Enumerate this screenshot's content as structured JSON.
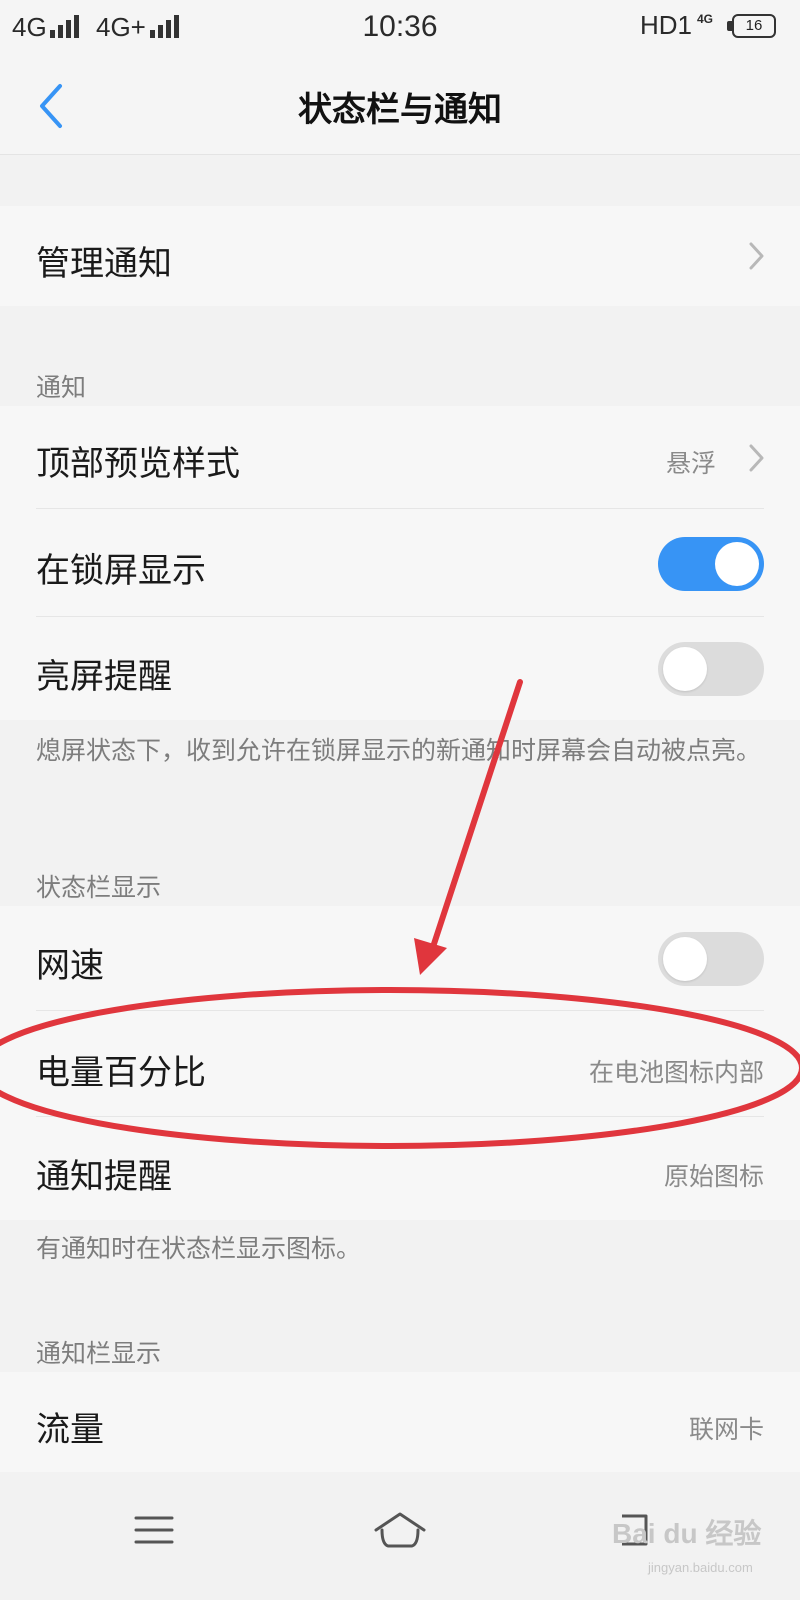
{
  "status_bar": {
    "carrier1": "4G",
    "carrier2": "4G+",
    "time": "10:36",
    "right_label": "HD1",
    "small_label": "4G",
    "battery": "16"
  },
  "header": {
    "title": "状态栏与通知",
    "back_icon": "chevron-left-icon"
  },
  "manage": {
    "label": "管理通知"
  },
  "notification_section": {
    "header": "通知",
    "rows": [
      {
        "label": "顶部预览样式",
        "value": "悬浮"
      },
      {
        "label": "在锁屏显示",
        "toggle": true
      },
      {
        "label": "亮屏提醒",
        "toggle": false
      }
    ],
    "description": "熄屏状态下，收到允许在锁屏显示的新通知时屏幕会自动被点亮。"
  },
  "status_bar_section": {
    "header": "状态栏显示",
    "rows": [
      {
        "label": "网速",
        "toggle": false
      },
      {
        "label": "电量百分比",
        "value": "在电池图标内部"
      },
      {
        "label": "通知提醒",
        "value": "原始图标"
      }
    ],
    "description": "有通知时在状态栏显示图标。"
  },
  "notification_bar_section": {
    "header": "通知栏显示",
    "rows": [
      {
        "label": "流量",
        "value": "联网卡"
      }
    ]
  },
  "bottom_nav": {
    "icons": [
      "menu-icon",
      "home-icon",
      "back-nav-icon"
    ]
  },
  "colors": {
    "accent": "#3794f5",
    "annotation": "#e0363d"
  },
  "watermark": {
    "text": "Bai du 经验",
    "sub": "jingyan.baidu.com"
  }
}
